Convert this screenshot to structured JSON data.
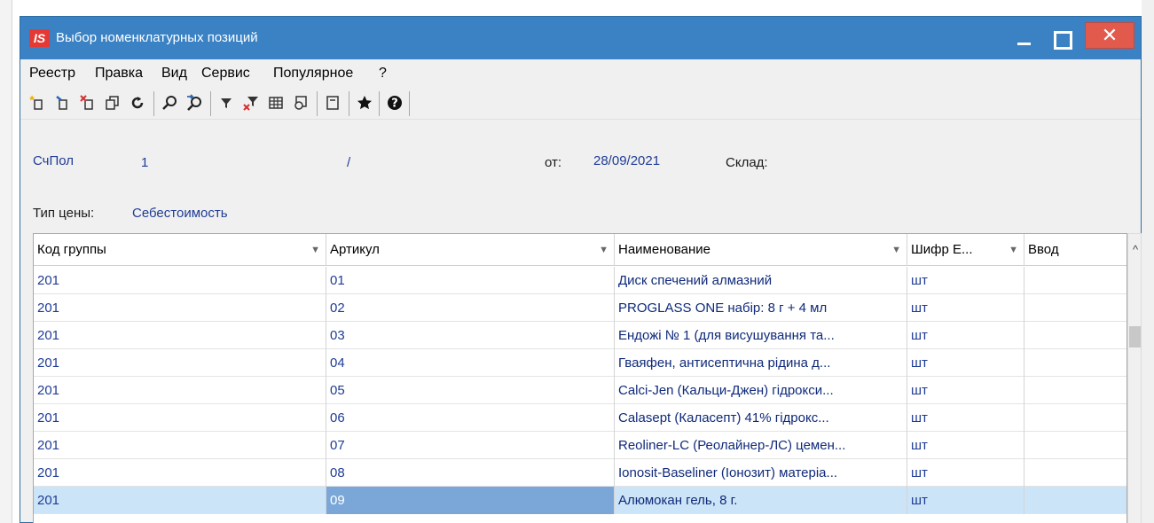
{
  "window": {
    "title": "Выбор номенклатурных позиций",
    "logo": "IS"
  },
  "menu": [
    "Реестр",
    "Правка",
    "Вид",
    "Сервис",
    "Популярное",
    "?"
  ],
  "toolbar": {
    "icons": [
      "new-icon",
      "edit-icon",
      "delete-icon",
      "copy-icon",
      "refresh-icon",
      "find-icon",
      "find-next-icon",
      "filter-icon",
      "clear-filter-icon",
      "table-icon",
      "view-icon",
      "form-icon",
      "favorite-icon",
      "help-icon"
    ]
  },
  "header": {
    "doc_label": "СчПол",
    "doc_number": "1",
    "doc_separator": "/",
    "date_label": "от:",
    "date_value": "28/09/2021",
    "warehouse_label": "Склад:",
    "price_type_label": "Тип цены:",
    "price_type_value": "Себестоимость"
  },
  "table": {
    "columns": [
      "Код группы",
      "Артикул",
      "Наименование",
      "Шифр Е...",
      "Ввод"
    ],
    "rows": [
      {
        "group": "201",
        "article": "01",
        "name": "Диск спечений алмазний",
        "unit": "шт",
        "input": ""
      },
      {
        "group": "201",
        "article": "02",
        "name": "PROGLASS ONE набір: 8 г + 4 мл",
        "unit": "шт",
        "input": ""
      },
      {
        "group": "201",
        "article": "03",
        "name": "Ендожі № 1 (для висушування та...",
        "unit": "шт",
        "input": ""
      },
      {
        "group": "201",
        "article": "04",
        "name": "Гваяфен, антисептична рідина д...",
        "unit": "шт",
        "input": ""
      },
      {
        "group": "201",
        "article": "05",
        "name": "Calci-Jen (Кальци-Джен) гідрокси...",
        "unit": "шт",
        "input": ""
      },
      {
        "group": "201",
        "article": "06",
        "name": "Calasept (Каласепт) 41% гідрокс...",
        "unit": "шт",
        "input": ""
      },
      {
        "group": "201",
        "article": "07",
        "name": "Reoliner-LC (Реолайнер-ЛС) цемен...",
        "unit": "шт",
        "input": ""
      },
      {
        "group": "201",
        "article": "08",
        "name": "Ionosit-Baseliner (Іонозит) матеріа...",
        "unit": "шт",
        "input": ""
      },
      {
        "group": "201",
        "article": "09",
        "name": "Алюмокан гель, 8 г.",
        "unit": "шт",
        "input": ""
      }
    ],
    "selected_row": 8
  },
  "colors": {
    "titlebar": "#3a82c4",
    "selection": "#cce4f7",
    "value_text": "#1f3c96",
    "close": "#e25a4c"
  }
}
